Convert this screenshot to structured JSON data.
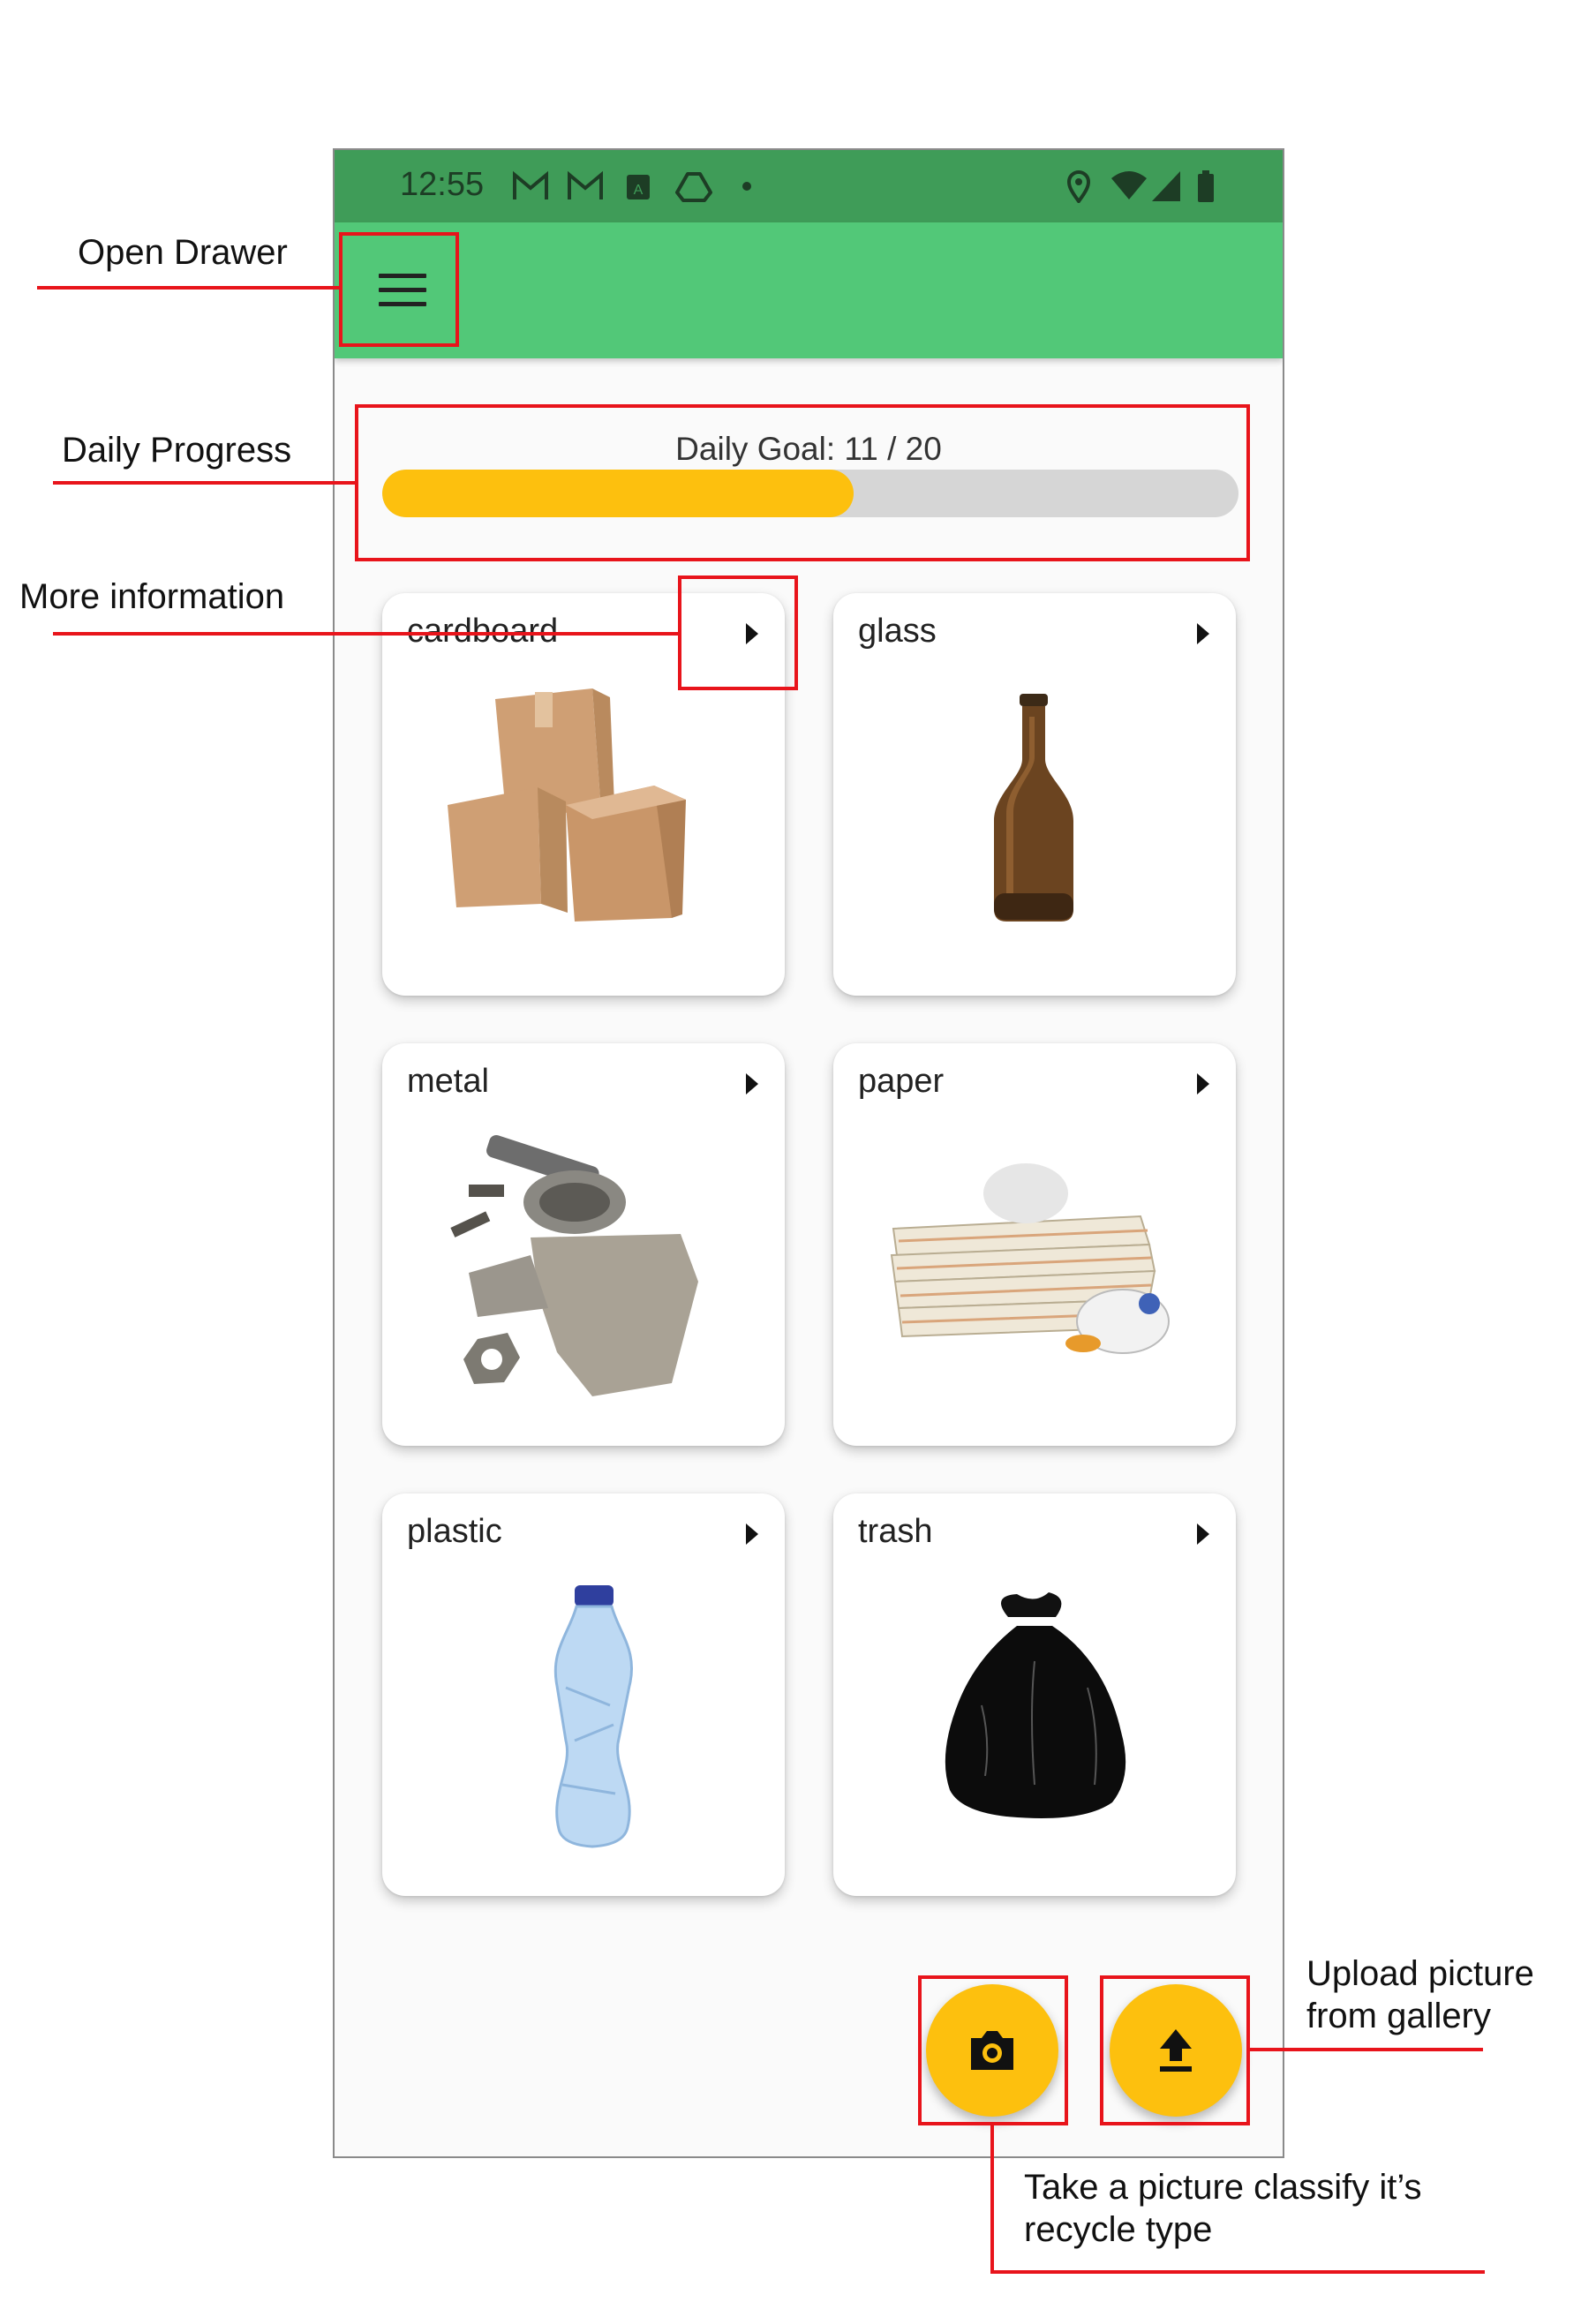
{
  "status_bar": {
    "time": "12:55",
    "left_icons": [
      "gmail-icon",
      "gmail-icon",
      "app-icon",
      "drive-icon",
      "dot-icon"
    ],
    "right_icons": [
      "location-icon",
      "wifi-icon",
      "signal-icon",
      "battery-icon"
    ]
  },
  "app_bar": {
    "menu_icon": "hamburger-menu-icon"
  },
  "progress": {
    "label": "Daily Goal:  11 / 20",
    "current": 11,
    "goal": 20,
    "fill_fraction": 0.55,
    "fill_color": "#fdc00e",
    "track_color": "#d6d6d6"
  },
  "categories": [
    {
      "label": "cardboard",
      "image": "cardboard-boxes-image"
    },
    {
      "label": "glass",
      "image": "glass-bottle-image"
    },
    {
      "label": "metal",
      "image": "scrap-metal-image"
    },
    {
      "label": "paper",
      "image": "paper-stack-image"
    },
    {
      "label": "plastic",
      "image": "plastic-bottle-image"
    },
    {
      "label": "trash",
      "image": "trash-bag-image"
    }
  ],
  "fabs": {
    "camera_icon": "camera-icon",
    "upload_icon": "upload-icon",
    "color": "#fdc00e"
  },
  "annotations": {
    "open_drawer": "Open Drawer",
    "daily_progress": "Daily Progress",
    "more_information": "More information",
    "upload_line1": "Upload picture",
    "upload_line2": "from gallery",
    "camera_line1": "Take a picture classify it’s",
    "camera_line2": "recycle type",
    "color": "#e8141b"
  },
  "colors": {
    "status_bar": "#3f9c58",
    "app_bar": "#52c878",
    "background": "#fafafa"
  }
}
